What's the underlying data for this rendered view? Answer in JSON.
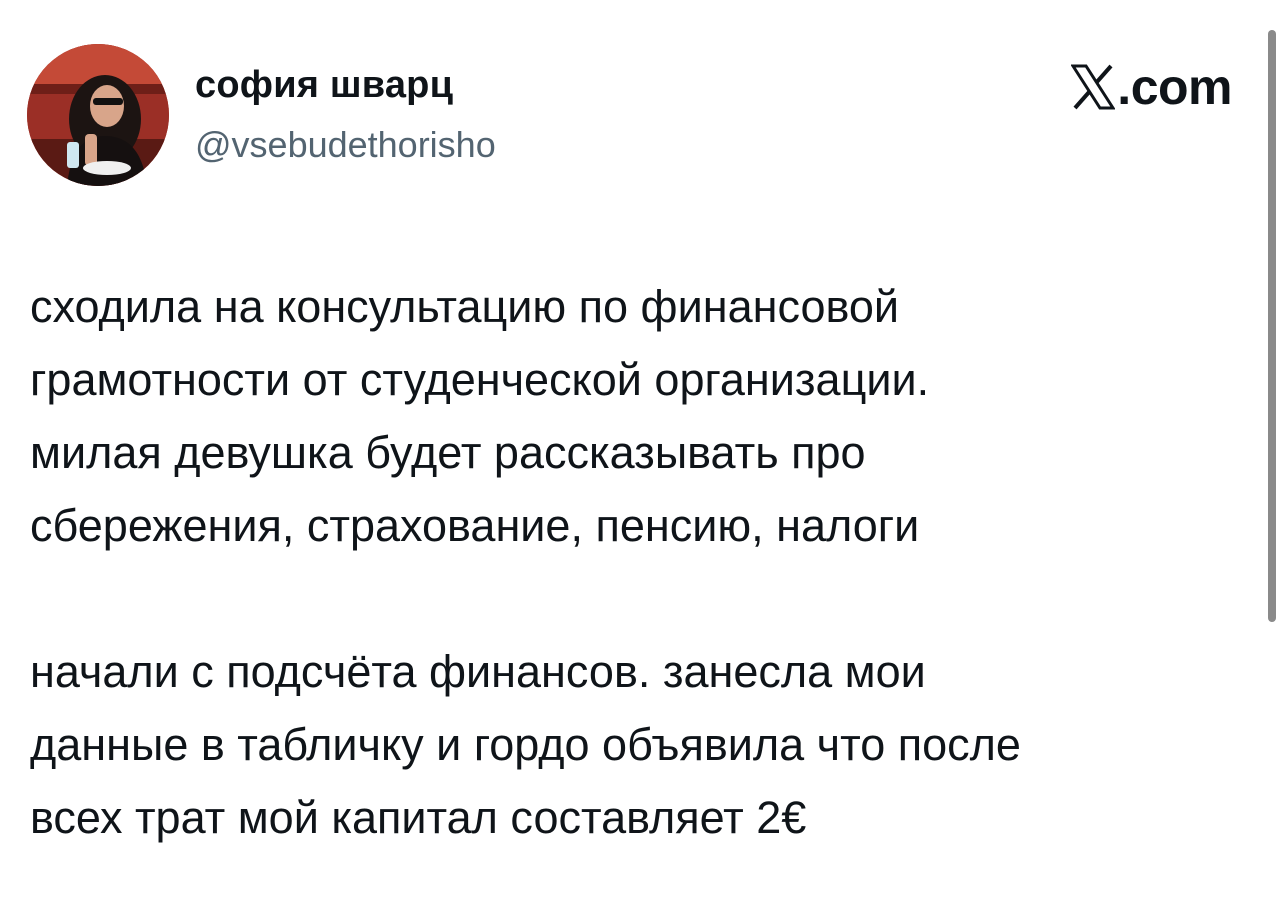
{
  "author": {
    "name": "софия шварц",
    "handle": "@vsebudethorisho",
    "avatar_icon": "profile-photo"
  },
  "brand": {
    "logo_icon": "x-logo-icon",
    "suffix": ".com"
  },
  "tweet": {
    "paragraphs": [
      "сходила на консультацию по финансовой\nграмотности от студенческой организации.\nмилая девушка будет рассказывать про\nсбережения, страхование, пенсию, налоги",
      "начали с подсчёта финансов. занесла мои\nданные в табличку и гордо объявила что после\nвсех трат мой капитал составляет 2€"
    ]
  },
  "colors": {
    "text": "#0f1419",
    "secondary": "#536471",
    "background": "#ffffff"
  }
}
